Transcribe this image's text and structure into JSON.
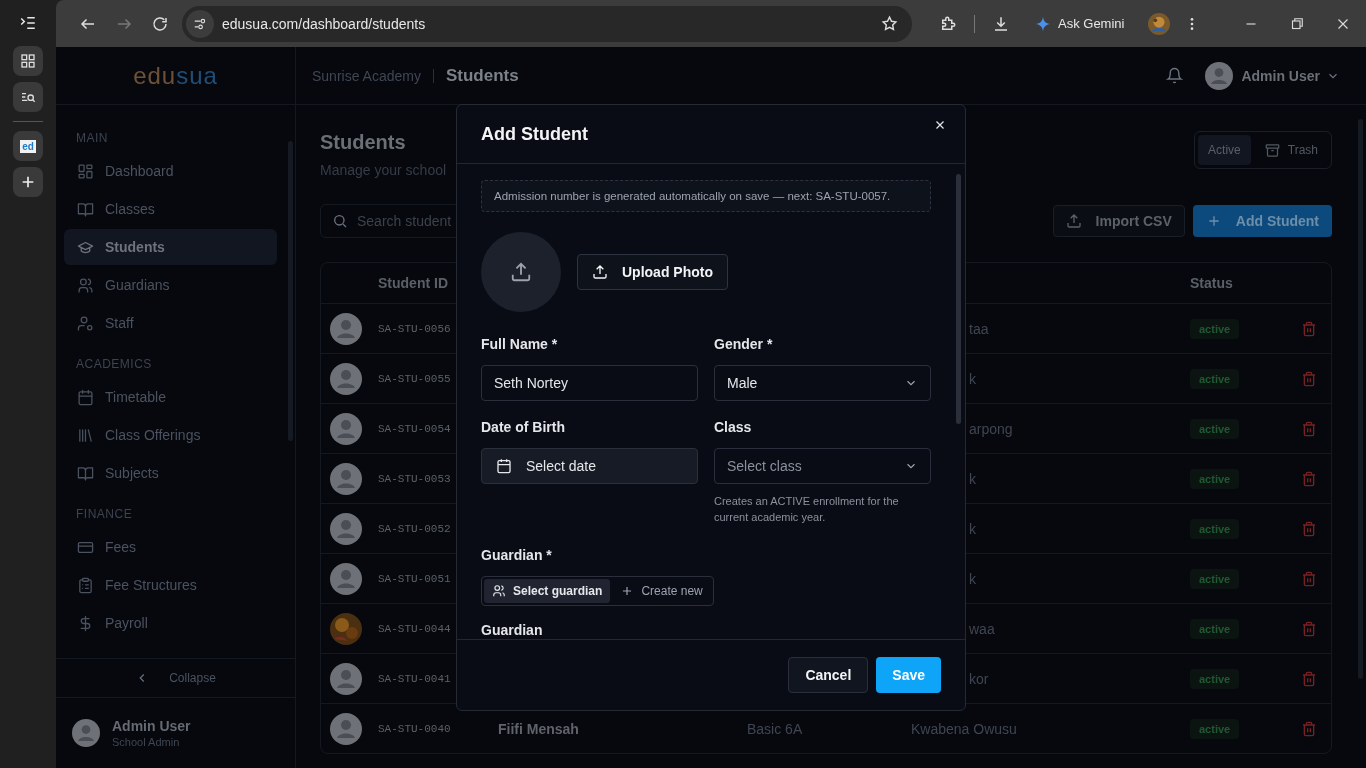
{
  "browser": {
    "favicon_text": "ed",
    "url": "edusua.com/dashboard/students",
    "gemini_label": "Ask Gemini"
  },
  "logo": {
    "text_1": "edu",
    "text_2": "sua"
  },
  "header": {
    "school": "Sunrise Academy",
    "page": "Students",
    "user": "Admin User"
  },
  "sidebar": {
    "sections": [
      {
        "title": "MAIN",
        "items": [
          {
            "label": "Dashboard",
            "selected": false
          },
          {
            "label": "Classes",
            "selected": false
          },
          {
            "label": "Students",
            "selected": true
          },
          {
            "label": "Guardians",
            "selected": false
          },
          {
            "label": "Staff",
            "selected": false
          }
        ]
      },
      {
        "title": "ACADEMICS",
        "items": [
          {
            "label": "Timetable",
            "selected": false
          },
          {
            "label": "Class Offerings",
            "selected": false
          },
          {
            "label": "Subjects",
            "selected": false
          }
        ]
      },
      {
        "title": "FINANCE",
        "items": [
          {
            "label": "Fees",
            "selected": false
          },
          {
            "label": "Fee Structures",
            "selected": false
          },
          {
            "label": "Payroll",
            "selected": false
          }
        ]
      }
    ],
    "collapse": "Collapse",
    "user_name": "Admin User",
    "user_role": "School Admin"
  },
  "page": {
    "title": "Students",
    "subtitle": "Manage your school",
    "search_placeholder": "Search student",
    "view_tabs": [
      {
        "label": "Active",
        "selected": true
      },
      {
        "label": "Trash",
        "selected": false
      }
    ],
    "import_button": "Import CSV",
    "add_button": "Add Student"
  },
  "table": {
    "columns": [
      "Student ID",
      "Status"
    ],
    "rows": [
      {
        "kind": "avatar",
        "student_id": "SA-STU-0056",
        "guardian": "taa",
        "status": "active"
      },
      {
        "kind": "avatar",
        "student_id": "SA-STU-0055",
        "guardian": "k",
        "status": "active"
      },
      {
        "kind": "avatar",
        "student_id": "SA-STU-0054",
        "guardian": "arpong",
        "status": "active"
      },
      {
        "kind": "avatar",
        "student_id": "SA-STU-0053",
        "guardian": "k",
        "status": "active"
      },
      {
        "kind": "avatar",
        "student_id": "SA-STU-0052",
        "guardian": "k",
        "status": "active"
      },
      {
        "kind": "avatar",
        "student_id": "SA-STU-0051",
        "guardian": "k",
        "status": "active"
      },
      {
        "kind": "picture",
        "student_id": "SA-STU-0044",
        "guardian": "waa",
        "status": "active"
      },
      {
        "kind": "avatar",
        "student_id": "SA-STU-0041",
        "guardian": "kor",
        "status": "active"
      },
      {
        "kind": "avatar",
        "student_id": "SA-STU-0040",
        "name": "Fiifi Mensah",
        "class": "Basic 6A",
        "guardian": "Kwabena Owusu",
        "status": "active"
      }
    ]
  },
  "modal": {
    "title": "Add Student",
    "note": "Admission number is generated automatically on save — next: SA-STU-0057.",
    "upload_button": "Upload Photo",
    "full_name": {
      "label": "Full Name *",
      "value": "Seth Nortey"
    },
    "gender": {
      "label": "Gender *",
      "value": "Male"
    },
    "dob": {
      "label": "Date of Birth",
      "value": "Select date"
    },
    "class": {
      "label": "Class",
      "placeholder": "Select class",
      "hint": "Creates an ACTIVE enrollment for the current academic year."
    },
    "guardian": {
      "label": "Guardian *",
      "options": [
        {
          "label": "Select guardian",
          "selected": true
        },
        {
          "label": "Create new",
          "selected": false
        }
      ]
    },
    "next_label": "Guardian",
    "cancel": "Cancel",
    "save": "Save"
  }
}
